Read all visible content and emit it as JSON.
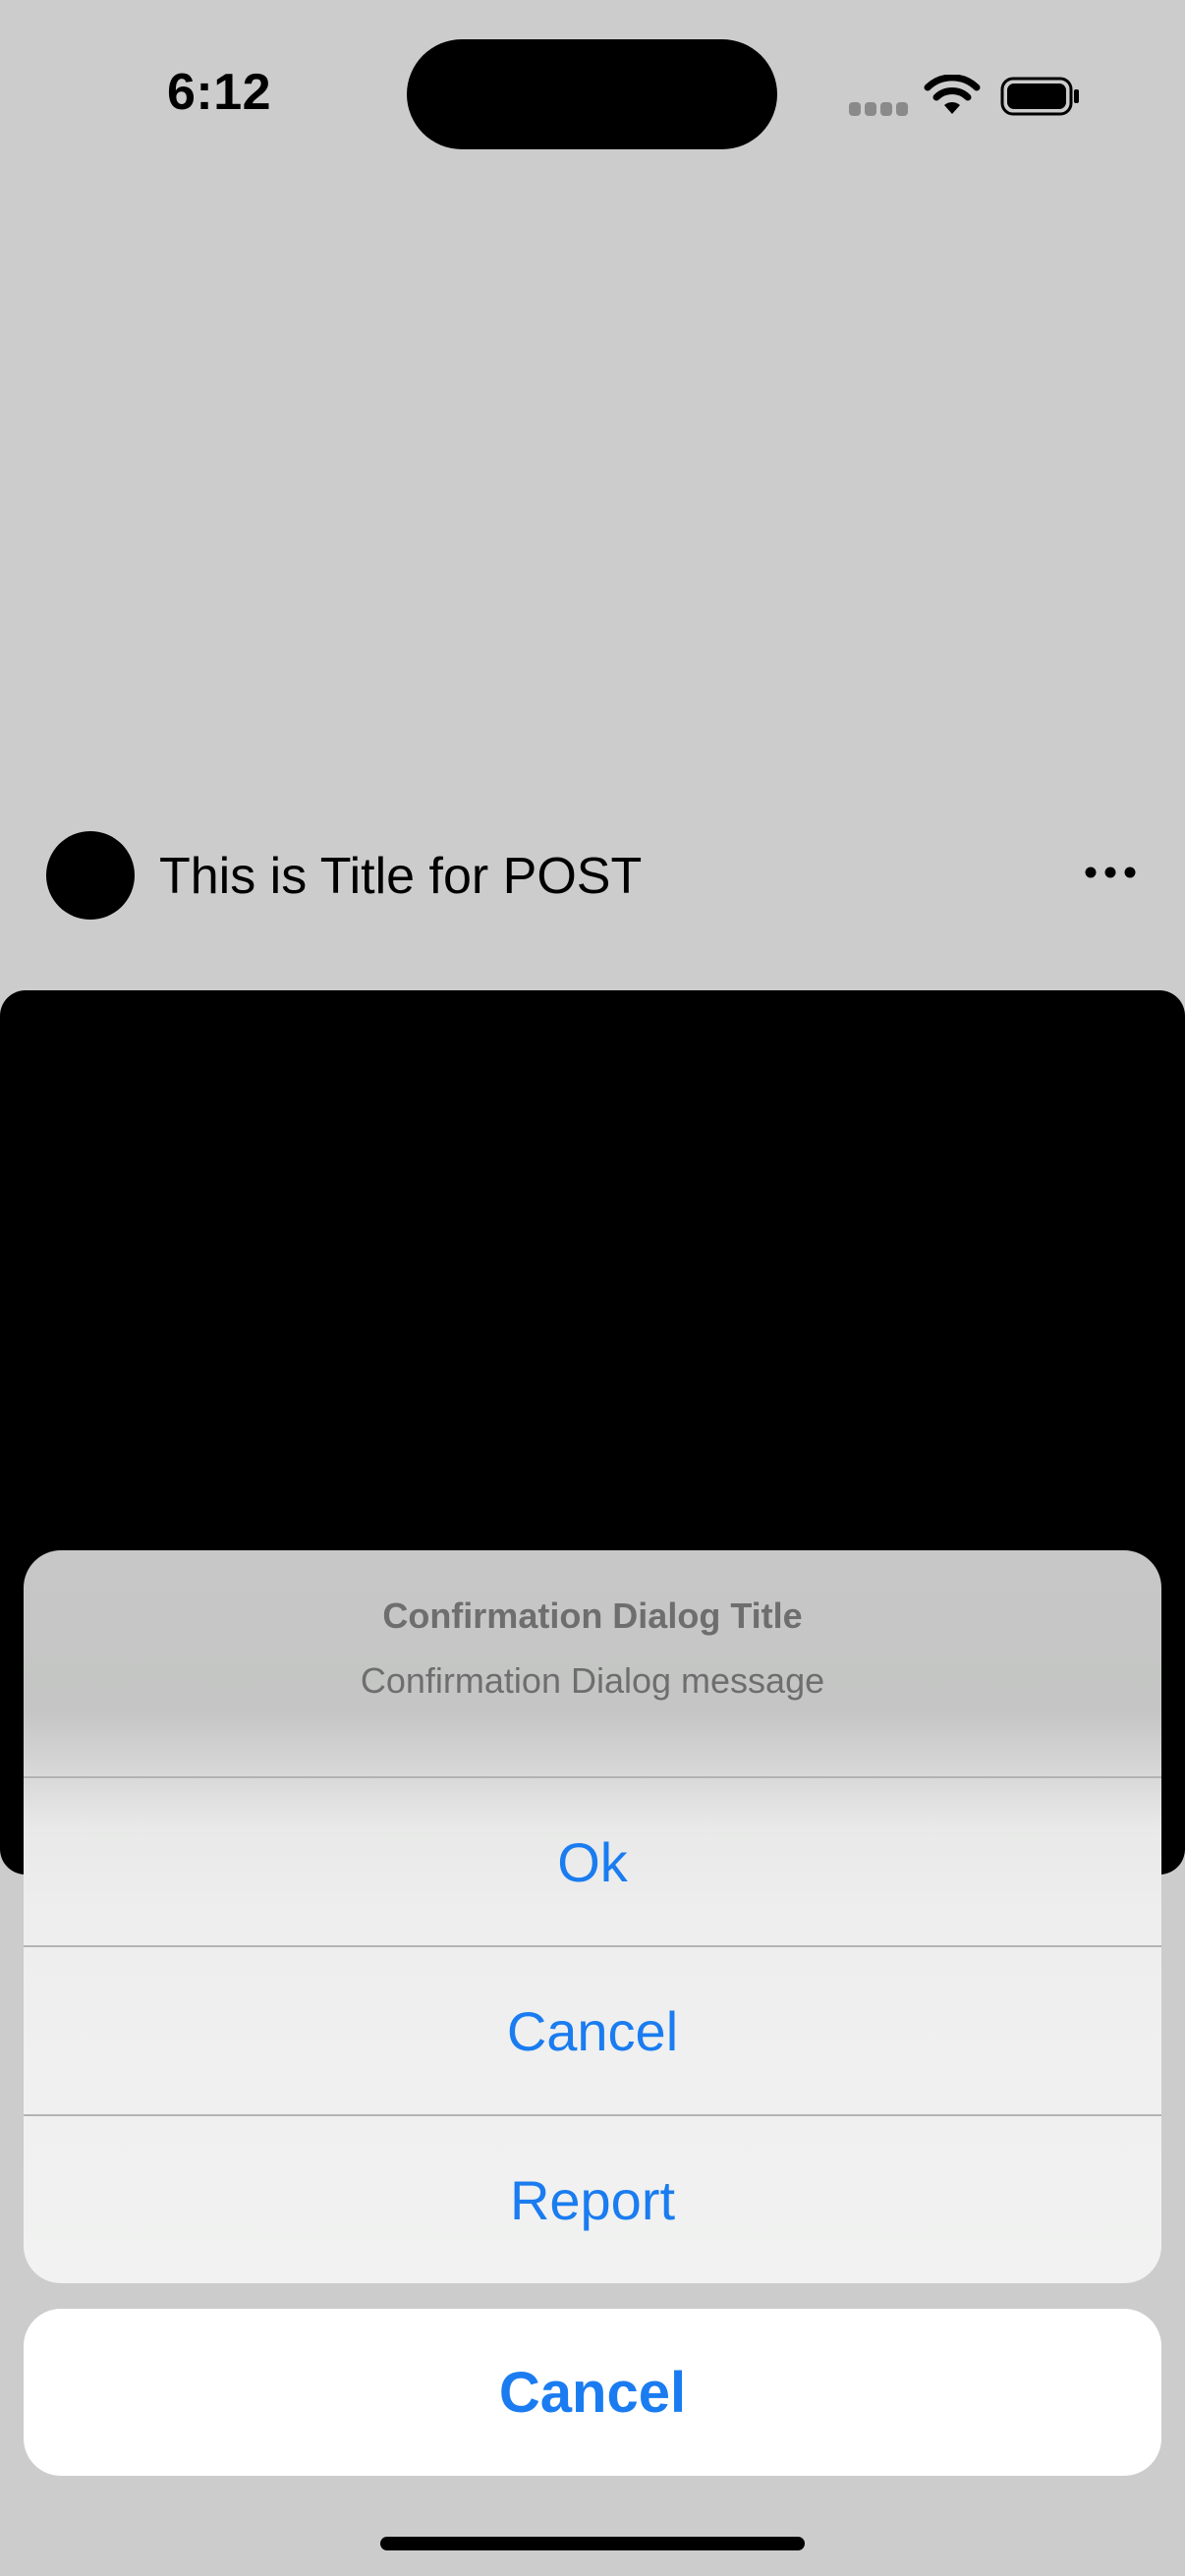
{
  "status_bar": {
    "time": "6:12"
  },
  "post": {
    "title": "This is Title for POST"
  },
  "dialog": {
    "title": "Confirmation Dialog Title",
    "message": "Confirmation Dialog message",
    "actions": [
      {
        "label": "Ok"
      },
      {
        "label": "Cancel"
      },
      {
        "label": "Report"
      }
    ],
    "cancel_label": "Cancel"
  },
  "colors": {
    "accent": "#1a7cf0",
    "background": "#cccccc",
    "sheet": "#ffffff"
  }
}
